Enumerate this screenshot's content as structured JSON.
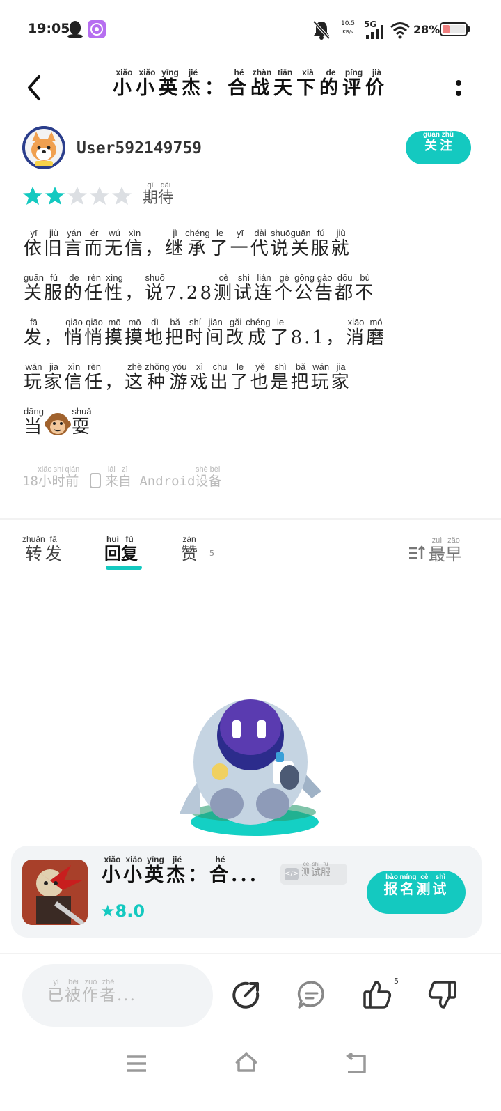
{
  "status_bar": {
    "time": "19:05",
    "net_speed_value": "10.5",
    "net_speed_unit": "KB/s",
    "network": "5G",
    "battery_pct": "28%"
  },
  "header": {
    "title_chars": [
      "小",
      "小",
      "英",
      "杰",
      "：",
      "合",
      "战",
      "天",
      "下",
      "的",
      "评",
      "价"
    ],
    "title_pinyin": [
      "xiǎo",
      "xiǎo",
      "yīng",
      "jié",
      "",
      "hé",
      "zhàn",
      "tiān",
      "xià",
      "de",
      "píng",
      "jià"
    ]
  },
  "user": {
    "name": "User592149759",
    "follow": {
      "char": "关注",
      "pinyin": "guān zhù"
    }
  },
  "rating": {
    "stars": 2,
    "max": 5,
    "label_chars": [
      "期",
      "待"
    ],
    "label_pinyin": [
      "qī",
      "dài"
    ]
  },
  "review": {
    "lines": [
      [
        [
          "依",
          "yī"
        ],
        [
          "旧",
          "jiù"
        ],
        [
          "言",
          "yán"
        ],
        [
          "而",
          "ér"
        ],
        [
          "无",
          "wú"
        ],
        [
          "信",
          "xìn"
        ],
        [
          "，",
          ""
        ],
        [
          "继",
          "jì"
        ],
        [
          "承",
          "chéng"
        ],
        [
          "了",
          "le"
        ],
        [
          "一",
          "yī"
        ],
        [
          "代",
          "dài"
        ],
        [
          "说",
          "shuō"
        ],
        [
          "关",
          "guān"
        ],
        [
          "服",
          "fú"
        ],
        [
          "就",
          "jiù"
        ]
      ],
      [
        [
          "关",
          "guān"
        ],
        [
          "服",
          "fú"
        ],
        [
          "的",
          "de"
        ],
        [
          "任",
          "rèn"
        ],
        [
          "性",
          "xìng"
        ],
        [
          "，",
          ""
        ],
        [
          "说",
          "shuō"
        ],
        [
          "7.28",
          ""
        ],
        [
          "测",
          "cè"
        ],
        [
          "试",
          "shì"
        ],
        [
          "连",
          "lián"
        ],
        [
          "个",
          "gè"
        ],
        [
          "公",
          "gōng"
        ],
        [
          "告",
          "gào"
        ],
        [
          "都",
          "dōu"
        ],
        [
          "不",
          "bù"
        ]
      ],
      [
        [
          "发",
          "fā"
        ],
        [
          "，",
          ""
        ],
        [
          "悄",
          "qiāo"
        ],
        [
          "悄",
          "qiāo"
        ],
        [
          "摸",
          "mō"
        ],
        [
          "摸",
          "mō"
        ],
        [
          "地",
          "dì"
        ],
        [
          "把",
          "bǎ"
        ],
        [
          "时",
          "shí"
        ],
        [
          "间",
          "jiān"
        ],
        [
          "改",
          "gǎi"
        ],
        [
          "成",
          "chéng"
        ],
        [
          "了",
          "le"
        ],
        [
          "8.1",
          ""
        ],
        [
          "，",
          ""
        ],
        [
          "消",
          "xiāo"
        ],
        [
          "磨",
          "mó"
        ]
      ],
      [
        [
          "玩",
          "wán"
        ],
        [
          "家",
          "jiā"
        ],
        [
          "信",
          "xìn"
        ],
        [
          "任",
          "rèn"
        ],
        [
          "，",
          ""
        ],
        [
          "这",
          "zhè"
        ],
        [
          "种",
          "zhǒng"
        ],
        [
          "游",
          "yóu"
        ],
        [
          "戏",
          "xì"
        ],
        [
          "出",
          "chū"
        ],
        [
          "了",
          "le"
        ],
        [
          "也",
          "yě"
        ],
        [
          "是",
          "shì"
        ],
        [
          "把",
          "bǎ"
        ],
        [
          "玩",
          "wán"
        ],
        [
          "家",
          "jiā"
        ]
      ],
      [
        [
          "当",
          "dāng"
        ],
        [
          "__MONKEY__",
          ""
        ],
        [
          "耍",
          "shuǎ"
        ]
      ]
    ]
  },
  "meta": {
    "time_num": "18",
    "time_chars": [
      [
        "小",
        "xiǎo"
      ],
      [
        "时",
        "shí"
      ],
      [
        "前",
        "qián"
      ]
    ],
    "from_chars": [
      [
        "来",
        "lái"
      ],
      [
        "自",
        "zì"
      ]
    ],
    "device": "Android",
    "device_chars": [
      [
        "设",
        "shè"
      ],
      [
        "备",
        "bèi"
      ]
    ]
  },
  "tabs": {
    "repost": {
      "chars": [
        [
          "转",
          "zhuǎn"
        ],
        [
          "发",
          "fā"
        ]
      ]
    },
    "reply": {
      "chars": [
        [
          "回",
          "huí"
        ],
        [
          "复",
          "fù"
        ]
      ]
    },
    "like": {
      "chars": [
        [
          "赞",
          "zàn"
        ]
      ],
      "count": "5"
    },
    "sort": {
      "chars": [
        [
          "最",
          "zuì"
        ],
        [
          "早",
          "zǎo"
        ]
      ]
    }
  },
  "game": {
    "name_chars": [
      [
        "小",
        "xiǎo"
      ],
      [
        "小",
        "xiǎo"
      ],
      [
        "英",
        "yīng"
      ],
      [
        "杰",
        "jié"
      ],
      [
        "：",
        ""
      ],
      [
        "合",
        "hé"
      ]
    ],
    "ellipsis": "...",
    "tag_chars": [
      [
        "测",
        "cè"
      ],
      [
        "试",
        "shì"
      ],
      [
        "服",
        "fú"
      ]
    ],
    "score": "8.0",
    "signup_chars": [
      [
        "报",
        "bào"
      ],
      [
        "名",
        "míng"
      ],
      [
        "测",
        "cè"
      ],
      [
        "试",
        "shì"
      ]
    ]
  },
  "bottom_bar": {
    "placeholder_chars": [
      [
        "已",
        "yǐ"
      ],
      [
        "被",
        "bèi"
      ],
      [
        "作",
        "zuò"
      ],
      [
        "者",
        "zhě"
      ]
    ],
    "placeholder_tail": "...",
    "like_count": "5"
  },
  "colors": {
    "accent": "#14c9c0",
    "star_empty": "#dcdfe3",
    "muted_text": "#bbbbbb"
  },
  "icons": [
    "back-icon",
    "more-icon",
    "star-icon",
    "device-icon",
    "sort-icon",
    "share-icon",
    "comment-icon",
    "thumbs-up-icon",
    "thumbs-down-icon",
    "menu-icon",
    "home-icon",
    "back-nav-icon"
  ]
}
